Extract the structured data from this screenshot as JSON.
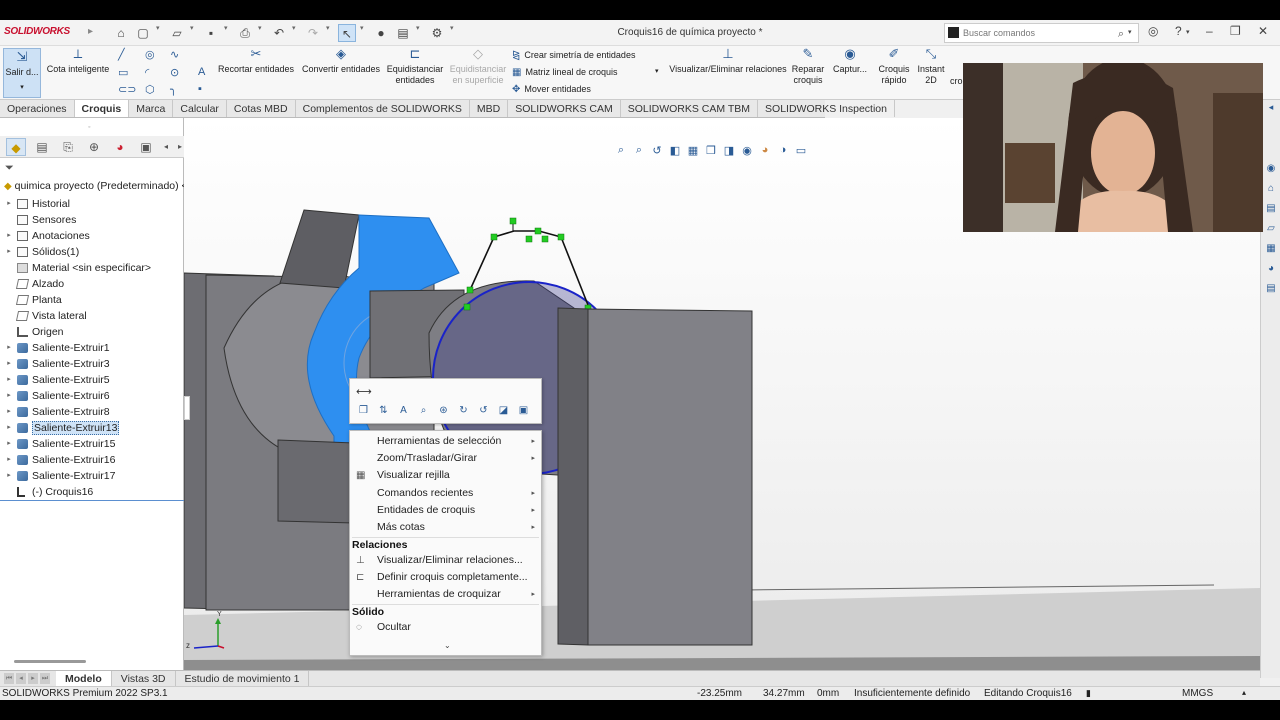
{
  "app": {
    "brand": "SOLIDWORKS",
    "document_title": "Croquis16 de química proyecto *",
    "search_placeholder": "Buscar comandos"
  },
  "ribbon": {
    "exit_sketch": "Salir d...",
    "smart_dimension": "Cota inteligente",
    "trim_entities": "Recortar entidades",
    "convert_entities": "Convertir entidades",
    "offset_entities_l1": "Equidistanciar",
    "offset_entities_l2": "entidades",
    "offset_surface_l1": "Equidistanciar",
    "offset_surface_l2": "en superficie",
    "mirror_entities": "Crear simetría de entidades",
    "linear_pattern": "Matriz lineal de croquis",
    "move_entities": "Mover entidades",
    "display_relations": "Visualizar/Eliminar relaciones",
    "repair_sketch_l1": "Reparar",
    "repair_sketch_l2": "croquis",
    "capture": "Captur...",
    "rapid_sketch_l1": "Croquis",
    "rapid_sketch_l2": "rápido",
    "instant2d_l1": "Instant",
    "instant2d_l2": "2D",
    "clipped": "cro"
  },
  "tabs": [
    "Operaciones",
    "Croquis",
    "Marca",
    "Calcular",
    "Cotas MBD",
    "Complementos de SOLIDWORKS",
    "MBD",
    "SOLIDWORKS CAM",
    "SOLIDWORKS CAM TBM",
    "SOLIDWORKS Inspection"
  ],
  "tree": {
    "root": "quimica proyecto  (Predeterminado) <",
    "items": [
      {
        "label": "Historial",
        "icon": "folder-icon",
        "arrow": true
      },
      {
        "label": "Sensores",
        "icon": "folder-icon",
        "arrow": false
      },
      {
        "label": "Anotaciones",
        "icon": "folder-icon",
        "arrow": true
      },
      {
        "label": "Sólidos(1)",
        "icon": "folder-icon",
        "arrow": true
      },
      {
        "label": "Material <sin especificar>",
        "icon": "material-icon",
        "arrow": false
      },
      {
        "label": "Alzado",
        "icon": "plane-icon",
        "arrow": false
      },
      {
        "label": "Planta",
        "icon": "plane-icon",
        "arrow": false
      },
      {
        "label": "Vista lateral",
        "icon": "plane-icon",
        "arrow": false
      },
      {
        "label": "Origen",
        "icon": "origin-icon",
        "arrow": false
      },
      {
        "label": "Saliente-Extruir1",
        "icon": "extrude-icon",
        "arrow": true
      },
      {
        "label": "Saliente-Extruir3",
        "icon": "extrude-icon",
        "arrow": true
      },
      {
        "label": "Saliente-Extruir5",
        "icon": "extrude-icon",
        "arrow": true
      },
      {
        "label": "Saliente-Extruir6",
        "icon": "extrude-icon",
        "arrow": true
      },
      {
        "label": "Saliente-Extruir8",
        "icon": "extrude-icon",
        "arrow": true
      },
      {
        "label": "Saliente-Extruir13",
        "icon": "extrude-icon",
        "arrow": true,
        "selected": true
      },
      {
        "label": "Saliente-Extruir15",
        "icon": "extrude-icon",
        "arrow": true
      },
      {
        "label": "Saliente-Extruir16",
        "icon": "extrude-icon",
        "arrow": true
      },
      {
        "label": "Saliente-Extruir17",
        "icon": "extrude-icon",
        "arrow": true
      },
      {
        "label": "(-) Croquis16",
        "icon": "sketch-icon",
        "arrow": false
      }
    ]
  },
  "context_menu": {
    "items": [
      {
        "label": "Herramientas de selección",
        "submenu": true
      },
      {
        "label": "Zoom/Trasladar/Girar",
        "submenu": true
      },
      {
        "label": "Visualizar rejilla",
        "submenu": false,
        "icon": "grid-icon"
      },
      {
        "label": "Comandos recientes",
        "submenu": true
      },
      {
        "label": "Entidades de croquis",
        "submenu": true
      },
      {
        "label": "Más cotas",
        "submenu": true
      }
    ],
    "relations_header": "Relaciones",
    "relations_items": [
      {
        "label": "Visualizar/Eliminar relaciones...",
        "submenu": false,
        "icon": "relations-icon"
      },
      {
        "label": "Definir croquis completamente...",
        "submenu": false,
        "icon": "fully-define-icon"
      },
      {
        "label": "Herramientas de croquizar",
        "submenu": true
      }
    ],
    "solid_header": "Sólido",
    "solid_items": [
      {
        "label": "Ocultar",
        "submenu": false,
        "icon": "hide-icon"
      }
    ]
  },
  "bottom_tabs": [
    "Modelo",
    "Vistas 3D",
    "Estudio de movimiento 1"
  ],
  "status": {
    "version": "SOLIDWORKS Premium 2022 SP3.1",
    "x": "-23.25mm",
    "y": "34.27mm",
    "z": "0mm",
    "definition": "Insuficientemente definido",
    "editing": "Editando Croquis16",
    "units": "MMGS"
  },
  "colors": {
    "accent": "#2a5b95",
    "brand": "#c8102e",
    "highlight_face": "#2e8ff0",
    "sketch_circle": "#1a23c8",
    "sketch_point": "#22cc22"
  }
}
